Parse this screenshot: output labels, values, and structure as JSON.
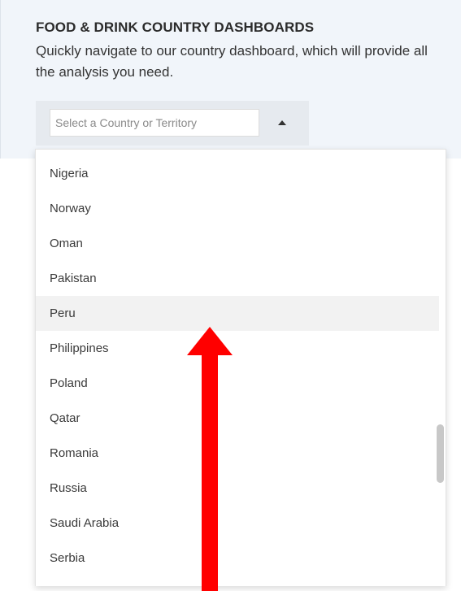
{
  "panel": {
    "title": "FOOD & DRINK COUNTRY DASHBOARDS",
    "description": "Quickly navigate to our country dashboard, which will provide all the analysis you need."
  },
  "select": {
    "placeholder": "Select a Country or Territory",
    "caret_icon": "caret-up-icon"
  },
  "dropdown": {
    "highlighted_index": 4,
    "options": [
      {
        "label": "Nigeria"
      },
      {
        "label": "Norway"
      },
      {
        "label": "Oman"
      },
      {
        "label": "Pakistan"
      },
      {
        "label": "Peru"
      },
      {
        "label": "Philippines"
      },
      {
        "label": "Poland"
      },
      {
        "label": "Qatar"
      },
      {
        "label": "Romania"
      },
      {
        "label": "Russia"
      },
      {
        "label": "Saudi Arabia"
      },
      {
        "label": "Serbia"
      }
    ]
  },
  "annotation": {
    "icon": "up-arrow-icon",
    "color": "#ff0000"
  },
  "colors": {
    "panel_background": "#f1f5fa",
    "highlight": "#f2f2f2"
  }
}
